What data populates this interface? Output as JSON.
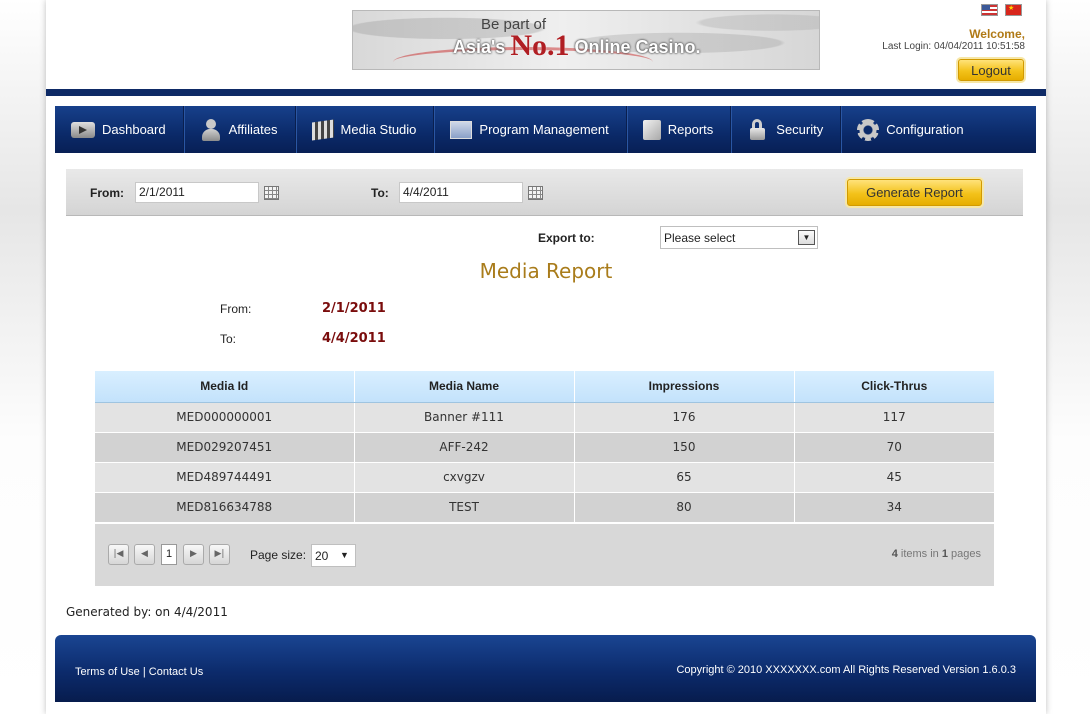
{
  "banner": {
    "line1": "Be part of",
    "asia": "Asia's",
    "no1": "No.1",
    "casino": "Online Casino."
  },
  "header": {
    "welcome": "Welcome,",
    "last_login": "Last Login: 04/04/2011 10:51:58",
    "logout_label": "Logout"
  },
  "nav": {
    "items": [
      {
        "label": "Dashboard",
        "icon": "dashboard-icon"
      },
      {
        "label": "Affiliates",
        "icon": "affiliates-icon"
      },
      {
        "label": "Media Studio",
        "icon": "media-studio-icon"
      },
      {
        "label": "Program Management",
        "icon": "program-management-icon"
      },
      {
        "label": "Reports",
        "icon": "reports-icon"
      },
      {
        "label": "Security",
        "icon": "lock-icon"
      },
      {
        "label": "Configuration",
        "icon": "gear-icon"
      }
    ]
  },
  "filter": {
    "from_label": "From:",
    "from_value": "2/1/2011",
    "to_label": "To:",
    "to_value": "4/4/2011",
    "generate_label": "Generate Report"
  },
  "export": {
    "label": "Export to:",
    "selected": "Please select"
  },
  "report": {
    "title": "Media Report",
    "from_label": "From:",
    "from_value": "2/1/2011",
    "to_label": "To:",
    "to_value": "4/4/2011"
  },
  "table": {
    "columns": [
      "Media Id",
      "Media Name",
      "Impressions",
      "Click-Thrus"
    ],
    "rows": [
      [
        "MED000000001",
        "Banner #111",
        "176",
        "117"
      ],
      [
        "MED029207451",
        "AFF-242",
        "150",
        "70"
      ],
      [
        "MED489744491",
        "cxvgzv",
        "65",
        "45"
      ],
      [
        "MED816634788",
        "TEST",
        "80",
        "34"
      ]
    ]
  },
  "pager": {
    "current_page": "1",
    "page_size_label": "Page size:",
    "page_size": "20",
    "info_count": "4",
    "info_items": " items in ",
    "info_pages_count": "1",
    "info_pages": " pages"
  },
  "generated_by": "Generated by:  on 4/4/2011",
  "footer": {
    "terms": "Terms of Use",
    "separator": " | ",
    "contact": "Contact Us",
    "copyright": "Copyright © 2010 XXXXXXX.com All Rights Reserved  Version 1.6.0.3"
  }
}
